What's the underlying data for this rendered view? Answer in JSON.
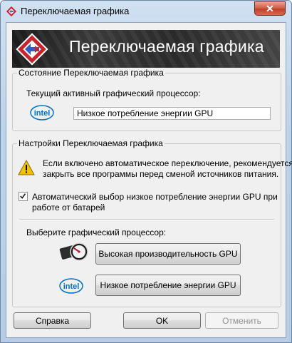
{
  "window": {
    "title": "Переключаемая графика",
    "close_glyph": "✕"
  },
  "banner": {
    "title": "Переключаемая графика"
  },
  "status_group": {
    "legend": "Состояние Переключаемая графика",
    "current_gpu_label": "Текущий активный графический процессор:",
    "current_gpu_value": "Низкое потребление энергии GPU",
    "logo_text": "intel"
  },
  "settings_group": {
    "legend": "Настройки Переключаемая графика",
    "warning_text_line1": "Если включено автоматическое переключение, рекомендуется",
    "warning_text_line2": "закрыть все программы перед сменой источников питания.",
    "auto_switch_checkbox": {
      "checked": true,
      "label_line1": "Автоматический выбор низкое потребление энергии GPU при",
      "label_line2": "работе от батарей"
    },
    "choose_gpu_label": "Выберите графический процессор:",
    "high_perf_button": "Высокая производительность GPU",
    "low_power_button": "Низкое потребление энергии GPU",
    "logo_text": "intel"
  },
  "footer": {
    "help_button": "Справка",
    "ok_button": "OK",
    "cancel_button": "Отменить"
  },
  "colors": {
    "titlebar": "#bcd2ea",
    "close_button": "#c0402a",
    "banner_bg": "#2a2a2a",
    "intel_blue": "#0071c5",
    "warning_yellow": "#f2c200"
  }
}
